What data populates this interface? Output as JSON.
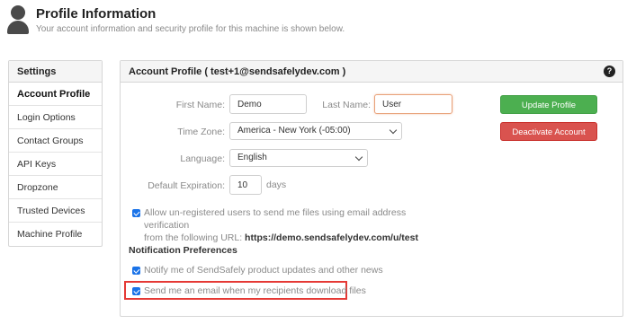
{
  "header": {
    "title": "Profile Information",
    "subtitle": "Your account information and security profile for this machine is shown below."
  },
  "sidebar": {
    "heading": "Settings",
    "items": [
      {
        "label": "Account Profile",
        "active": true
      },
      {
        "label": "Login Options"
      },
      {
        "label": "Contact Groups"
      },
      {
        "label": "API Keys"
      },
      {
        "label": "Dropzone"
      },
      {
        "label": "Trusted Devices"
      },
      {
        "label": "Machine Profile"
      }
    ]
  },
  "panel": {
    "heading": "Account Profile ( test+1@sendsafelydev.com )",
    "help_icon": "?"
  },
  "form": {
    "first_name_label": "First Name:",
    "first_name_value": "Demo",
    "last_name_label": "Last Name:",
    "last_name_value": "User",
    "time_zone_label": "Time Zone:",
    "time_zone_value": "America - New York (-05:00)",
    "language_label": "Language:",
    "language_value": "English",
    "expiration_label": "Default Expiration:",
    "expiration_value": "10",
    "expiration_suffix": "days",
    "allow_unregistered_line1": "Allow un-registered users to send me files using email address verification",
    "allow_unregistered_line2_prefix": "from the following URL: ",
    "allow_unregistered_url": "https://demo.sendsafelydev.com/u/test"
  },
  "buttons": {
    "update_profile": "Update Profile",
    "deactivate_account": "Deactivate Account"
  },
  "notifications": {
    "title": "Notification Preferences",
    "product_updates": "Notify me of SendSafely product updates and other news",
    "download_email": "Send me an email when my recipients download files"
  },
  "colors": {
    "accent_blue": "#1a73e8",
    "update_green": "#4caf50",
    "deactivate_red": "#d9534f",
    "highlight_red": "#e53935"
  }
}
